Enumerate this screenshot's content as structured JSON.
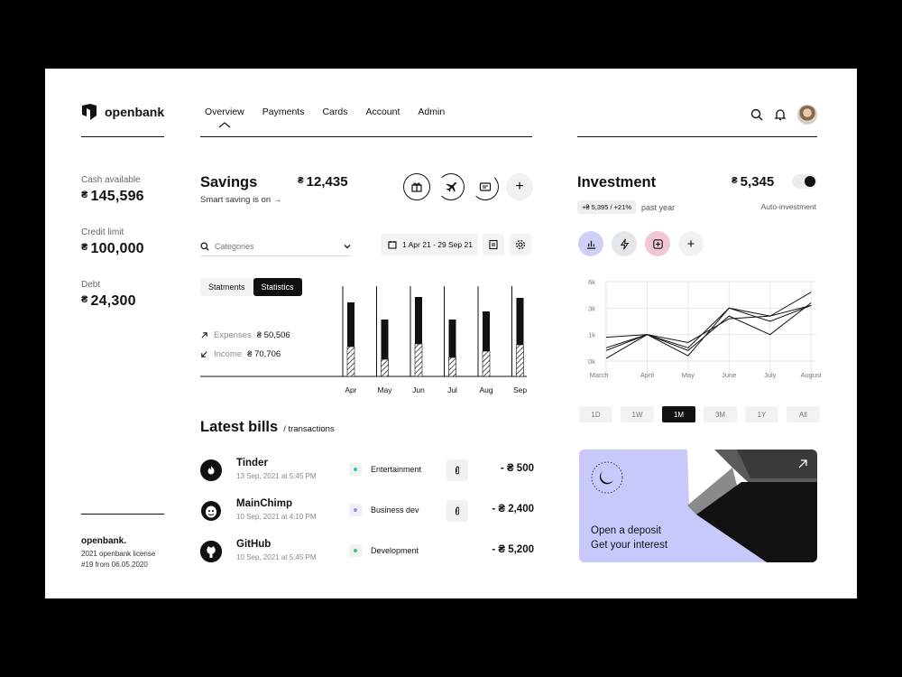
{
  "brand": {
    "name": "openbank"
  },
  "nav": {
    "items": [
      "Overview",
      "Payments",
      "Cards",
      "Account",
      "Admin"
    ],
    "active": "Overview"
  },
  "stats": [
    {
      "label": "Cash available",
      "currency": "₴",
      "value": "145,596"
    },
    {
      "label": "Credit limit",
      "currency": "₴",
      "value": "100,000"
    },
    {
      "label": "Debt",
      "currency": "₴",
      "value": "24,300"
    }
  ],
  "footer": {
    "brand": "openbank.",
    "line1": "2021 openbank license",
    "line2": "#19 from 06.05.2020"
  },
  "savings": {
    "title": "Savings",
    "subtitle": "Smart saving is on →",
    "currency": "₴",
    "amount": "12,435",
    "category_placeholder": "Categories",
    "date_range": "1 Apr 21 - 29 Sep 21",
    "tabs": [
      "Statments",
      "Statistics"
    ],
    "active_tab": "Statistics",
    "expenses_label": "Expenses",
    "expenses_value": "₴ 50,506",
    "income_label": "Income",
    "income_value": "₴ 70,706"
  },
  "chart_data": [
    {
      "type": "bar",
      "categories": [
        "Apr",
        "May",
        "Jun",
        "Jul",
        "Aug",
        "Sep"
      ],
      "series": [
        {
          "name": "Expenses",
          "values": [
            0.82,
            0.63,
            0.88,
            0.63,
            0.72,
            0.87
          ]
        },
        {
          "name": "Income",
          "values": [
            0.33,
            0.19,
            0.36,
            0.21,
            0.28,
            0.35
          ]
        }
      ],
      "ylim": [
        0,
        1
      ]
    },
    {
      "type": "line",
      "categories": [
        "March",
        "April",
        "May",
        "June",
        "July",
        "August"
      ],
      "yticks": [
        "0k",
        "1k",
        "3k",
        "6k"
      ],
      "series": [
        {
          "values": [
            0.5,
            1.0,
            0.5,
            2.0,
            1.7,
            2.6
          ]
        },
        {
          "values": [
            0.9,
            1.0,
            0.2,
            2.0,
            1.5,
            2.1
          ]
        },
        {
          "values": [
            0.1,
            1.0,
            0.7,
            1.6,
            1.7,
            2.1
          ]
        },
        {
          "values": [
            0.4,
            1.0,
            0.4,
            1.7,
            1.0,
            2.2
          ]
        }
      ],
      "grid": true
    }
  ],
  "bills": {
    "title": "Latest bills",
    "subtitle": "/ transactions",
    "items": [
      {
        "name": "Tinder",
        "date": "13 Sep, 2021 at 5:45 PM",
        "category": "Entertainment",
        "dot_color": "#36c2c0",
        "amount": "- ₴ 500",
        "icon": "tinder-icon"
      },
      {
        "name": "MainChimp",
        "date": "10 Sep, 2021 at 4:10 PM",
        "category": "Business dev",
        "dot_color": "#8f8ff0",
        "amount": "- ₴ 2,400",
        "icon": "mailchimp-icon"
      },
      {
        "name": "GitHub",
        "date": "10 Sep, 2021 at 5:45 PM",
        "category": "Development",
        "dot_color": "#4cbf7a",
        "amount": "- ₴ 5,200",
        "icon": "github-icon"
      }
    ]
  },
  "investment": {
    "title": "Investment",
    "currency": "₴",
    "amount": "5,345",
    "chip": "+₴ 5,395 / +21%",
    "period": "past year",
    "auto_label": "Auto-investment",
    "auto_on": true,
    "ranges": [
      "1D",
      "1W",
      "1M",
      "3M",
      "1Y",
      "All"
    ],
    "active_range": "1M"
  },
  "promo": {
    "line1": "Open a deposit",
    "line2": "Get your interest",
    "badge": "openbank · openbank ·"
  },
  "colors": {
    "accent_purple": "#c9c8fb",
    "pink": "#f2c7d3",
    "grey_blue": "#e3e7ea"
  }
}
